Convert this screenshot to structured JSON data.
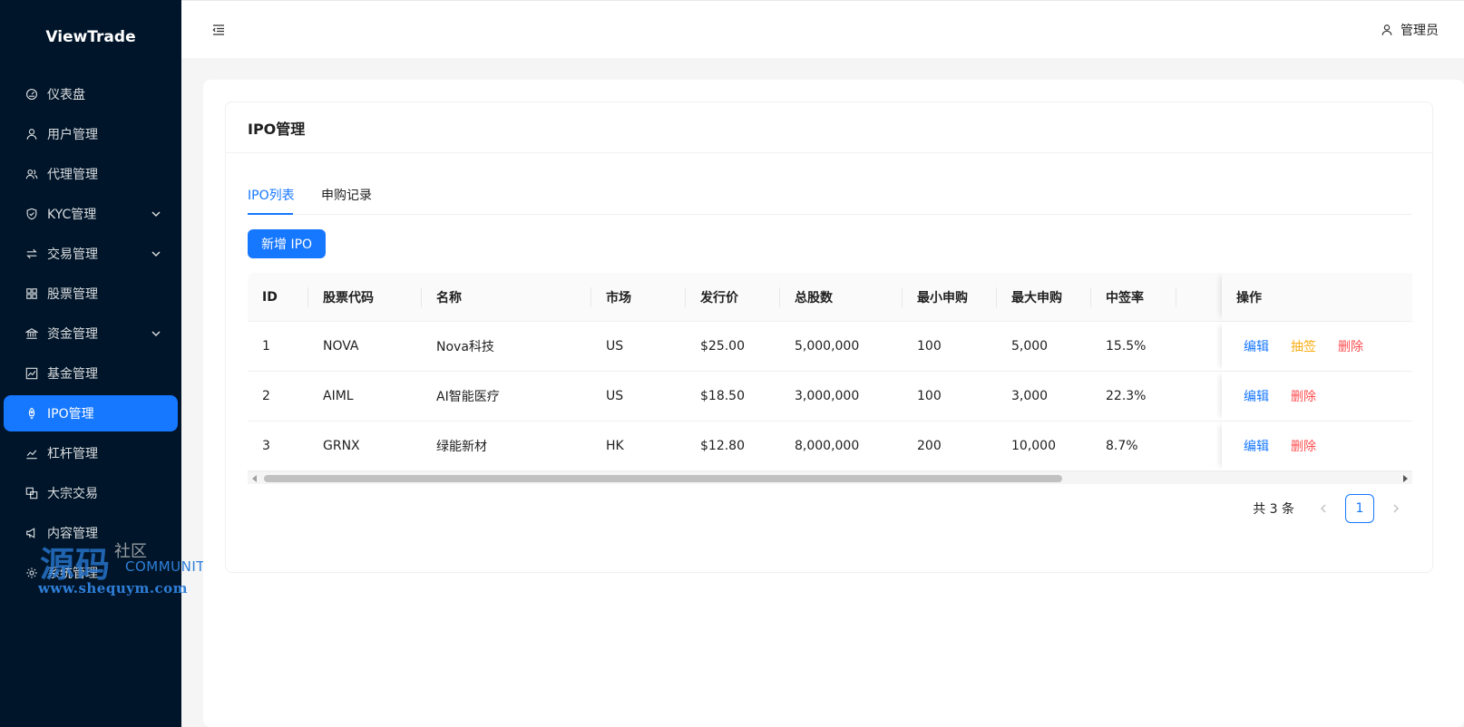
{
  "app": {
    "logo": "ViewTrade"
  },
  "sidebar": {
    "items": [
      {
        "label": "仪表盘",
        "icon": "dashboard-icon"
      },
      {
        "label": "用户管理",
        "icon": "user-icon"
      },
      {
        "label": "代理管理",
        "icon": "team-icon"
      },
      {
        "label": "KYC管理",
        "icon": "shield-icon",
        "expandable": true
      },
      {
        "label": "交易管理",
        "icon": "swap-icon",
        "expandable": true
      },
      {
        "label": "股票管理",
        "icon": "grid-icon"
      },
      {
        "label": "资金管理",
        "icon": "bank-icon",
        "expandable": true
      },
      {
        "label": "基金管理",
        "icon": "line-chart-icon"
      },
      {
        "label": "IPO管理",
        "icon": "rocket-icon",
        "active": true
      },
      {
        "label": "杠杆管理",
        "icon": "stock-icon"
      },
      {
        "label": "大宗交易",
        "icon": "block-icon"
      },
      {
        "label": "内容管理",
        "icon": "notification-icon"
      },
      {
        "label": "系统管理",
        "icon": "setting-icon"
      }
    ]
  },
  "watermark": {
    "big": "源码",
    "small": "社区",
    "community": "COMMUNITY",
    "url": "www.shequym.com"
  },
  "header": {
    "user": "管理员"
  },
  "page": {
    "title": "IPO管理",
    "tabs": [
      {
        "label": "IPO列表",
        "active": true
      },
      {
        "label": "申购记录"
      }
    ],
    "add_button": "新增 IPO"
  },
  "table": {
    "columns": [
      "ID",
      "股票代码",
      "名称",
      "市场",
      "发行价",
      "总股数",
      "最小申购",
      "最大申购",
      "中签率",
      "操作"
    ],
    "rows": [
      {
        "id": "1",
        "code": "NOVA",
        "name": "Nova科技",
        "market": "US",
        "price": "$25.00",
        "shares": "5,000,000",
        "min": "100",
        "max": "5,000",
        "rate": "15.5%",
        "ops": [
          "编辑",
          "抽签",
          "删除"
        ]
      },
      {
        "id": "2",
        "code": "AIML",
        "name": "AI智能医疗",
        "market": "US",
        "price": "$18.50",
        "shares": "3,000,000",
        "min": "100",
        "max": "3,000",
        "rate": "22.3%",
        "ops": [
          "编辑",
          "删除"
        ]
      },
      {
        "id": "3",
        "code": "GRNX",
        "name": "绿能新材",
        "market": "HK",
        "price": "$12.80",
        "shares": "8,000,000",
        "min": "200",
        "max": "10,000",
        "rate": "8.7%",
        "ops": [
          "编辑",
          "删除"
        ]
      }
    ]
  },
  "pagination": {
    "total": "共 3 条",
    "current": "1"
  },
  "colors": {
    "sidebar_bg": "#001529",
    "primary": "#1677ff",
    "warning": "#faad14",
    "danger": "#ff4d4f"
  }
}
